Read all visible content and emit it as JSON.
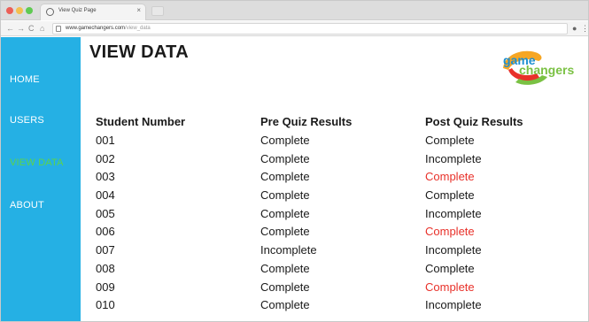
{
  "browser": {
    "tab_title": "View Quiz Page",
    "url_host": "www.gamechangers.com",
    "url_path": "/view_data"
  },
  "sidebar": {
    "items": [
      {
        "label": "HOME",
        "active": false
      },
      {
        "label": "USERS",
        "active": false
      },
      {
        "label": "VIEW DATA",
        "active": true
      },
      {
        "label": "ABOUT",
        "active": false
      }
    ]
  },
  "page": {
    "title": "VIEW DATA"
  },
  "logo": {
    "line1": "game",
    "line2": "changers"
  },
  "table": {
    "headers": [
      "Student Number",
      "Pre Quiz Results",
      "Post Quiz Results"
    ],
    "rows": [
      {
        "student": "001",
        "pre": "Complete",
        "post": "Complete"
      },
      {
        "student": "002",
        "pre": "Complete",
        "post": "Incomplete"
      },
      {
        "student": "003",
        "pre": "Complete",
        "post": "Complete",
        "post_highlight": true
      },
      {
        "student": "004",
        "pre": "Complete",
        "post": "Complete"
      },
      {
        "student": "005",
        "pre": "Complete",
        "post": "Incomplete"
      },
      {
        "student": "006",
        "pre": "Complete",
        "post": "Complete",
        "post_highlight": true
      },
      {
        "student": "007",
        "pre": "Incomplete",
        "post": "Incomplete"
      },
      {
        "student": "008",
        "pre": "Complete",
        "post": "Complete"
      },
      {
        "student": "009",
        "pre": "Complete",
        "post": "Complete",
        "post_highlight": true
      },
      {
        "student": "010",
        "pre": "Complete",
        "post": "Incomplete"
      }
    ]
  },
  "colors": {
    "sidebar_bg": "#25b0e4",
    "nav_active": "#5dd34a",
    "highlight_text": "#e8312a"
  },
  "icons": {
    "tab_favicon": "globe-icon",
    "account": "account-icon",
    "menu": "more-vertical-icon"
  }
}
